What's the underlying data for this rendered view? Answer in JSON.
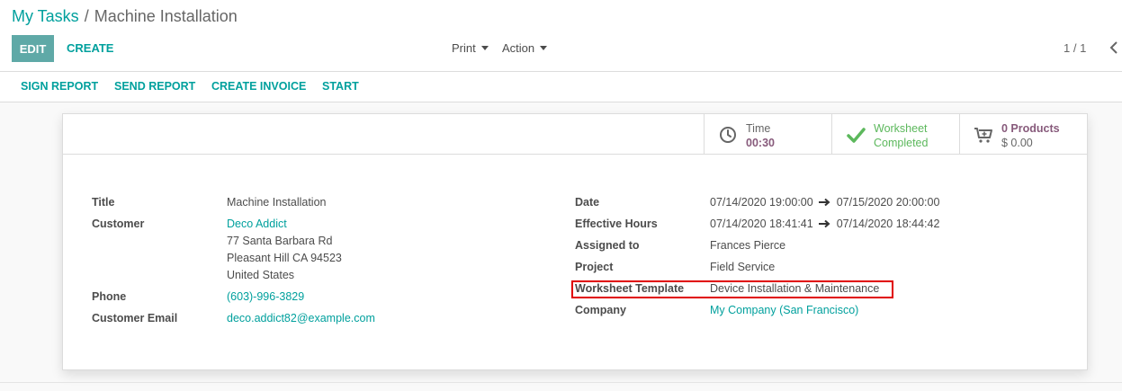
{
  "breadcrumb": {
    "parent": "My Tasks",
    "separator": "/",
    "current": "Machine Installation"
  },
  "toolbar": {
    "edit_label": "EDIT",
    "create_label": "CREATE",
    "print_label": "Print",
    "action_label": "Action"
  },
  "pager": {
    "value": "1 / 1",
    "prev_icon": "chevron-left-icon"
  },
  "statusbar": {
    "buttons": [
      "SIGN REPORT",
      "SEND REPORT",
      "CREATE INVOICE",
      "START"
    ]
  },
  "stat_buttons": {
    "time": {
      "label": "Time",
      "value": "00:30",
      "icon": "clock-icon"
    },
    "worksheet": {
      "line1": "Worksheet",
      "line2": "Completed",
      "icon": "check-icon"
    },
    "products": {
      "line1": "0 Products",
      "line2": "$ 0.00",
      "icon": "cart-plus-icon"
    }
  },
  "left_fields": {
    "title_label": "Title",
    "title_value": "Machine Installation",
    "customer_label": "Customer",
    "customer_name": "Deco Addict",
    "customer_address": [
      "77 Santa Barbara Rd",
      "Pleasant Hill CA 94523",
      "United States"
    ],
    "phone_label": "Phone",
    "phone_value": "(603)-996-3829",
    "email_label": "Customer Email",
    "email_value": "deco.addict82@example.com"
  },
  "right_fields": {
    "date_label": "Date",
    "date_start": "07/14/2020 19:00:00",
    "date_end": "07/15/2020 20:00:00",
    "effective_label": "Effective Hours",
    "effective_start": "07/14/2020 18:41:41",
    "effective_end": "07/14/2020 18:44:42",
    "assigned_label": "Assigned to",
    "assigned_value": "Frances Pierce",
    "project_label": "Project",
    "project_value": "Field Service",
    "worksheet_template_label": "Worksheet Template",
    "worksheet_template_value": "Device Installation & Maintenance",
    "company_label": "Company",
    "company_value": "My Company (San Francisco)"
  },
  "colors": {
    "primary": "#00A09D",
    "edit_button": "#5fa9a7",
    "accent_purple": "#875A7B",
    "success": "#5cb85c",
    "highlight": "#e00000"
  }
}
